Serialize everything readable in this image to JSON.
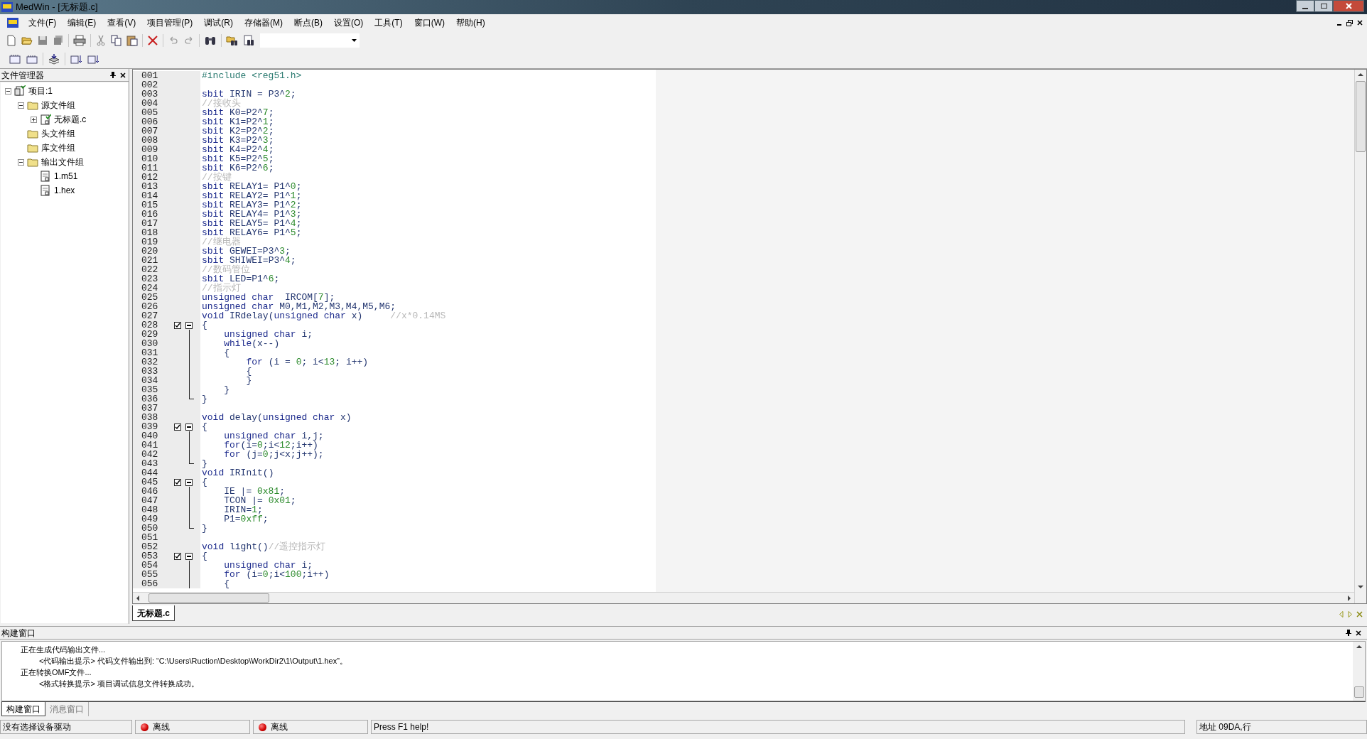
{
  "window": {
    "title": "MedWin - [无标题.c]"
  },
  "menu": [
    "文件(F)",
    "编辑(E)",
    "查看(V)",
    "项目管理(P)",
    "调试(R)",
    "存储器(M)",
    "断点(B)",
    "设置(O)",
    "工具(T)",
    "窗口(W)",
    "帮助(H)"
  ],
  "file_manager": {
    "title": "文件管理器",
    "tree": [
      {
        "label": "项目:1",
        "kind": "project",
        "expanded": true,
        "children": [
          {
            "label": "源文件组",
            "kind": "folder",
            "expanded": true,
            "children": [
              {
                "label": "无标题.c",
                "kind": "source",
                "expanded": false
              }
            ]
          },
          {
            "label": "头文件组",
            "kind": "folder"
          },
          {
            "label": "库文件组",
            "kind": "folder"
          },
          {
            "label": "输出文件组",
            "kind": "folder",
            "expanded": true,
            "children": [
              {
                "label": "1.m51",
                "kind": "document"
              },
              {
                "label": "1.hex",
                "kind": "document"
              }
            ]
          }
        ]
      }
    ]
  },
  "editor": {
    "lines": [
      {
        "n": "001",
        "kind": "plain",
        "tokens": [
          {
            "kind": "directive",
            "text": "#include <reg51.h>"
          }
        ]
      },
      {
        "n": "002",
        "kind": "plain"
      },
      {
        "n": "003",
        "kind": "plain",
        "tokens": [
          {
            "kind": "keyword",
            "text": "sbit"
          },
          {
            "kind": "plain",
            "text": " IRIN = P3^"
          },
          {
            "kind": "number",
            "text": "2"
          },
          {
            "kind": "plain",
            "text": ";"
          }
        ]
      },
      {
        "n": "004",
        "kind": "plain",
        "tokens": [
          {
            "kind": "comment",
            "text": "//接收头"
          }
        ]
      },
      {
        "n": "005",
        "kind": "plain",
        "tokens": [
          {
            "kind": "keyword",
            "text": "sbit"
          },
          {
            "kind": "plain",
            "text": " K0=P2^"
          },
          {
            "kind": "number",
            "text": "7"
          },
          {
            "kind": "plain",
            "text": ";"
          }
        ]
      },
      {
        "n": "006",
        "kind": "plain",
        "tokens": [
          {
            "kind": "keyword",
            "text": "sbit"
          },
          {
            "kind": "plain",
            "text": " K1=P2^"
          },
          {
            "kind": "number",
            "text": "1"
          },
          {
            "kind": "plain",
            "text": ";"
          }
        ]
      },
      {
        "n": "007",
        "kind": "plain",
        "tokens": [
          {
            "kind": "keyword",
            "text": "sbit"
          },
          {
            "kind": "plain",
            "text": " K2=P2^"
          },
          {
            "kind": "number",
            "text": "2"
          },
          {
            "kind": "plain",
            "text": ";"
          }
        ]
      },
      {
        "n": "008",
        "kind": "plain",
        "tokens": [
          {
            "kind": "keyword",
            "text": "sbit"
          },
          {
            "kind": "plain",
            "text": " K3=P2^"
          },
          {
            "kind": "number",
            "text": "3"
          },
          {
            "kind": "plain",
            "text": ";"
          }
        ]
      },
      {
        "n": "009",
        "kind": "plain",
        "tokens": [
          {
            "kind": "keyword",
            "text": "sbit"
          },
          {
            "kind": "plain",
            "text": " K4=P2^"
          },
          {
            "kind": "number",
            "text": "4"
          },
          {
            "kind": "plain",
            "text": ";"
          }
        ]
      },
      {
        "n": "010",
        "kind": "plain",
        "tokens": [
          {
            "kind": "keyword",
            "text": "sbit"
          },
          {
            "kind": "plain",
            "text": " K5=P2^"
          },
          {
            "kind": "number",
            "text": "5"
          },
          {
            "kind": "plain",
            "text": ";"
          }
        ]
      },
      {
        "n": "011",
        "kind": "plain",
        "tokens": [
          {
            "kind": "keyword",
            "text": "sbit"
          },
          {
            "kind": "plain",
            "text": " K6=P2^"
          },
          {
            "kind": "number",
            "text": "6"
          },
          {
            "kind": "plain",
            "text": ";"
          }
        ]
      },
      {
        "n": "012",
        "kind": "plain",
        "tokens": [
          {
            "kind": "comment",
            "text": "//按键"
          }
        ]
      },
      {
        "n": "013",
        "kind": "plain",
        "tokens": [
          {
            "kind": "keyword",
            "text": "sbit"
          },
          {
            "kind": "plain",
            "text": " RELAY1= P1^"
          },
          {
            "kind": "number",
            "text": "0"
          },
          {
            "kind": "plain",
            "text": ";"
          }
        ]
      },
      {
        "n": "014",
        "kind": "plain",
        "tokens": [
          {
            "kind": "keyword",
            "text": "sbit"
          },
          {
            "kind": "plain",
            "text": " RELAY2= P1^"
          },
          {
            "kind": "number",
            "text": "1"
          },
          {
            "kind": "plain",
            "text": ";"
          }
        ]
      },
      {
        "n": "015",
        "kind": "plain",
        "tokens": [
          {
            "kind": "keyword",
            "text": "sbit"
          },
          {
            "kind": "plain",
            "text": " RELAY3= P1^"
          },
          {
            "kind": "number",
            "text": "2"
          },
          {
            "kind": "plain",
            "text": ";"
          }
        ]
      },
      {
        "n": "016",
        "kind": "plain",
        "tokens": [
          {
            "kind": "keyword",
            "text": "sbit"
          },
          {
            "kind": "plain",
            "text": " RELAY4= P1^"
          },
          {
            "kind": "number",
            "text": "3"
          },
          {
            "kind": "plain",
            "text": ";"
          }
        ]
      },
      {
        "n": "017",
        "kind": "plain",
        "tokens": [
          {
            "kind": "keyword",
            "text": "sbit"
          },
          {
            "kind": "plain",
            "text": " RELAY5= P1^"
          },
          {
            "kind": "number",
            "text": "4"
          },
          {
            "kind": "plain",
            "text": ";"
          }
        ]
      },
      {
        "n": "018",
        "kind": "plain",
        "tokens": [
          {
            "kind": "keyword",
            "text": "sbit"
          },
          {
            "kind": "plain",
            "text": " RELAY6= P1^"
          },
          {
            "kind": "number",
            "text": "5"
          },
          {
            "kind": "plain",
            "text": ";"
          }
        ]
      },
      {
        "n": "019",
        "kind": "plain",
        "tokens": [
          {
            "kind": "comment",
            "text": "//继电器"
          }
        ]
      },
      {
        "n": "020",
        "kind": "plain",
        "tokens": [
          {
            "kind": "keyword",
            "text": "sbit"
          },
          {
            "kind": "plain",
            "text": " GEWEI=P3^"
          },
          {
            "kind": "number",
            "text": "3"
          },
          {
            "kind": "plain",
            "text": ";"
          }
        ]
      },
      {
        "n": "021",
        "kind": "plain",
        "tokens": [
          {
            "kind": "keyword",
            "text": "sbit"
          },
          {
            "kind": "plain",
            "text": " SHIWEI=P3^"
          },
          {
            "kind": "number",
            "text": "4"
          },
          {
            "kind": "plain",
            "text": ";"
          }
        ]
      },
      {
        "n": "022",
        "kind": "plain",
        "tokens": [
          {
            "kind": "comment",
            "text": "//数码管位"
          }
        ]
      },
      {
        "n": "023",
        "kind": "plain",
        "tokens": [
          {
            "kind": "keyword",
            "text": "sbit"
          },
          {
            "kind": "plain",
            "text": " LED=P1^"
          },
          {
            "kind": "number",
            "text": "6"
          },
          {
            "kind": "plain",
            "text": ";"
          }
        ]
      },
      {
        "n": "024",
        "kind": "plain",
        "tokens": [
          {
            "kind": "comment",
            "text": "//指示灯"
          }
        ]
      },
      {
        "n": "025",
        "kind": "plain",
        "tokens": [
          {
            "kind": "keyword",
            "text": "unsigned char"
          },
          {
            "kind": "plain",
            "text": "  IRCOM["
          },
          {
            "kind": "number",
            "text": "7"
          },
          {
            "kind": "plain",
            "text": "];"
          }
        ]
      },
      {
        "n": "026",
        "kind": "plain",
        "tokens": [
          {
            "kind": "keyword",
            "text": "unsigned char"
          },
          {
            "kind": "plain",
            "text": " M0,M1,M2,M3,M4,M5,M6;"
          }
        ]
      },
      {
        "n": "027",
        "kind": "plain",
        "tokens": [
          {
            "kind": "keyword",
            "text": "void"
          },
          {
            "kind": "plain",
            "text": " IRdelay("
          },
          {
            "kind": "keyword",
            "text": "unsigned char"
          },
          {
            "kind": "plain",
            "text": " x)     "
          },
          {
            "kind": "comment",
            "text": "//x*0.14MS"
          }
        ]
      },
      {
        "n": "028",
        "kind": "fold_start",
        "tokens": [
          {
            "kind": "plain",
            "text": "{"
          }
        ]
      },
      {
        "n": "029",
        "kind": "fold_body",
        "tokens": [
          {
            "kind": "keyword",
            "text": "    unsigned char"
          },
          {
            "kind": "plain",
            "text": " i;"
          }
        ]
      },
      {
        "n": "030",
        "kind": "fold_body",
        "tokens": [
          {
            "kind": "keyword",
            "text": "    while"
          },
          {
            "kind": "plain",
            "text": "(x--)"
          }
        ]
      },
      {
        "n": "031",
        "kind": "fold_body",
        "tokens": [
          {
            "kind": "plain",
            "text": "    {"
          }
        ]
      },
      {
        "n": "032",
        "kind": "fold_body",
        "tokens": [
          {
            "kind": "keyword",
            "text": "        for"
          },
          {
            "kind": "plain",
            "text": " (i = "
          },
          {
            "kind": "number",
            "text": "0"
          },
          {
            "kind": "plain",
            "text": "; i<"
          },
          {
            "kind": "number",
            "text": "13"
          },
          {
            "kind": "plain",
            "text": "; i++)"
          }
        ]
      },
      {
        "n": "033",
        "kind": "fold_body",
        "tokens": [
          {
            "kind": "plain",
            "text": "        {"
          }
        ]
      },
      {
        "n": "034",
        "kind": "fold_body",
        "tokens": [
          {
            "kind": "plain",
            "text": "        }"
          }
        ]
      },
      {
        "n": "035",
        "kind": "fold_body",
        "tokens": [
          {
            "kind": "plain",
            "text": "    }"
          }
        ]
      },
      {
        "n": "036",
        "kind": "fold_end",
        "tokens": [
          {
            "kind": "plain",
            "text": "}"
          }
        ]
      },
      {
        "n": "037",
        "kind": "plain"
      },
      {
        "n": "038",
        "kind": "plain",
        "tokens": [
          {
            "kind": "keyword",
            "text": "void"
          },
          {
            "kind": "plain",
            "text": " delay("
          },
          {
            "kind": "keyword",
            "text": "unsigned char"
          },
          {
            "kind": "plain",
            "text": " x)"
          }
        ]
      },
      {
        "n": "039",
        "kind": "fold_start",
        "tokens": [
          {
            "kind": "plain",
            "text": "{"
          }
        ]
      },
      {
        "n": "040",
        "kind": "fold_body",
        "tokens": [
          {
            "kind": "keyword",
            "text": "    unsigned char"
          },
          {
            "kind": "plain",
            "text": " i,j;"
          }
        ]
      },
      {
        "n": "041",
        "kind": "fold_body",
        "tokens": [
          {
            "kind": "keyword",
            "text": "    for"
          },
          {
            "kind": "plain",
            "text": "(i="
          },
          {
            "kind": "number",
            "text": "0"
          },
          {
            "kind": "plain",
            "text": ";i<"
          },
          {
            "kind": "number",
            "text": "12"
          },
          {
            "kind": "plain",
            "text": ";i++)"
          }
        ]
      },
      {
        "n": "042",
        "kind": "fold_body",
        "tokens": [
          {
            "kind": "keyword",
            "text": "    for"
          },
          {
            "kind": "plain",
            "text": " (j="
          },
          {
            "kind": "number",
            "text": "0"
          },
          {
            "kind": "plain",
            "text": ";j<x;j++);"
          }
        ]
      },
      {
        "n": "043",
        "kind": "fold_end",
        "tokens": [
          {
            "kind": "plain",
            "text": "}"
          }
        ]
      },
      {
        "n": "044",
        "kind": "plain",
        "tokens": [
          {
            "kind": "keyword",
            "text": "void"
          },
          {
            "kind": "plain",
            "text": " IRInit()"
          }
        ]
      },
      {
        "n": "045",
        "kind": "fold_start",
        "tokens": [
          {
            "kind": "plain",
            "text": "{"
          }
        ]
      },
      {
        "n": "046",
        "kind": "fold_body",
        "tokens": [
          {
            "kind": "plain",
            "text": "    IE |= "
          },
          {
            "kind": "number",
            "text": "0x81"
          },
          {
            "kind": "plain",
            "text": ";"
          }
        ]
      },
      {
        "n": "047",
        "kind": "fold_body",
        "tokens": [
          {
            "kind": "plain",
            "text": "    TCON |= "
          },
          {
            "kind": "number",
            "text": "0x01"
          },
          {
            "kind": "plain",
            "text": ";"
          }
        ]
      },
      {
        "n": "048",
        "kind": "fold_body",
        "tokens": [
          {
            "kind": "plain",
            "text": "    IRIN="
          },
          {
            "kind": "number",
            "text": "1"
          },
          {
            "kind": "plain",
            "text": ";"
          }
        ]
      },
      {
        "n": "049",
        "kind": "fold_body",
        "tokens": [
          {
            "kind": "plain",
            "text": "    P1="
          },
          {
            "kind": "number",
            "text": "0xff"
          },
          {
            "kind": "plain",
            "text": ";"
          }
        ]
      },
      {
        "n": "050",
        "kind": "fold_end",
        "tokens": [
          {
            "kind": "plain",
            "text": "}"
          }
        ]
      },
      {
        "n": "051",
        "kind": "plain"
      },
      {
        "n": "052",
        "kind": "plain",
        "tokens": [
          {
            "kind": "keyword",
            "text": "void"
          },
          {
            "kind": "plain",
            "text": " light()"
          },
          {
            "kind": "comment",
            "text": "//遥控指示灯"
          }
        ]
      },
      {
        "n": "053",
        "kind": "fold_start",
        "tokens": [
          {
            "kind": "plain",
            "text": "{"
          }
        ]
      },
      {
        "n": "054",
        "kind": "fold_body",
        "tokens": [
          {
            "kind": "keyword",
            "text": "    unsigned char"
          },
          {
            "kind": "plain",
            "text": " i;"
          }
        ]
      },
      {
        "n": "055",
        "kind": "fold_body",
        "tokens": [
          {
            "kind": "keyword",
            "text": "    for"
          },
          {
            "kind": "plain",
            "text": " (i="
          },
          {
            "kind": "number",
            "text": "0"
          },
          {
            "kind": "plain",
            "text": ";i<"
          },
          {
            "kind": "number",
            "text": "100"
          },
          {
            "kind": "plain",
            "text": ";i++)"
          }
        ]
      },
      {
        "n": "056",
        "kind": "fold_body",
        "tokens": [
          {
            "kind": "plain",
            "text": "    {"
          }
        ]
      }
    ],
    "tabs": [
      {
        "label": "无标题.c",
        "selected": true
      }
    ]
  },
  "build_window": {
    "title": "构建窗口",
    "output": [
      {
        "text": "正在生成代码输出文件...",
        "children": [
          {
            "text": "<代码输出提示> 代码文件输出到: “C:\\Users\\Ruction\\Desktop\\WorkDir2\\1\\Output\\1.hex”。"
          }
        ]
      },
      {
        "text": "正在转换OMF文件...",
        "children": [
          {
            "text": "<格式转换提示> 项目调试信息文件转换成功。"
          }
        ]
      }
    ],
    "tabs": [
      {
        "label": "构建窗口",
        "selected": true
      },
      {
        "label": "消息窗口",
        "selected": false
      }
    ]
  },
  "status_bar": [
    {
      "kind": "plain",
      "text": "没有选择设备驱动"
    },
    {
      "kind": "led",
      "text": "离线"
    },
    {
      "kind": "led",
      "text": "离线"
    },
    {
      "kind": "wide",
      "text": "Press F1 help!"
    },
    {
      "kind": "plain",
      "text": "地址 09DA,行"
    }
  ]
}
